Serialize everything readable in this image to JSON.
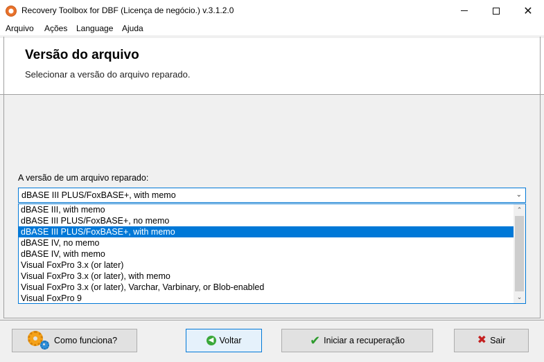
{
  "window": {
    "title": "Recovery Toolbox for DBF (Licença de negócio.) v.3.1.2.0",
    "icon": "app-logo-icon",
    "controls": {
      "minimize": "minimize-icon",
      "maximize": "maximize-icon",
      "close": "close-icon",
      "close_glyph": "✕"
    }
  },
  "menu": {
    "items": [
      "Arquivo",
      "Ações",
      "Language",
      "Ajuda"
    ]
  },
  "header": {
    "title": "Versão do arquivo",
    "subtitle": "Selecionar a versão do arquivo reparado."
  },
  "version_field": {
    "label": "A versão de um arquivo reparado:",
    "selected": "dBASE III PLUS/FoxBASE+, with memo",
    "chevron": "⌄",
    "options": [
      "dBASE III, with memo",
      "dBASE III PLUS/FoxBASE+, no memo",
      "dBASE III PLUS/FoxBASE+, with memo",
      "dBASE IV, no memo",
      "dBASE IV, with memo",
      "Visual FoxPro 3.x (or later)",
      "Visual FoxPro 3.x (or later), with memo",
      "Visual FoxPro 3.x (or later), Varchar, Varbinary, or Blob-enabled",
      "Visual FoxPro 9"
    ],
    "selected_index": 2,
    "scroll_up": "⌃",
    "scroll_down": "⌄"
  },
  "buttons": {
    "how_it_works": "Como funciona?",
    "back": "Voltar",
    "start_recovery": "Iniciar a recuperação",
    "exit": "Sair",
    "back_glyph": "◀",
    "check_glyph": "✔",
    "x_glyph": "✖"
  },
  "colors": {
    "selection": "#0078d7",
    "accent_border": "#0078d7"
  }
}
